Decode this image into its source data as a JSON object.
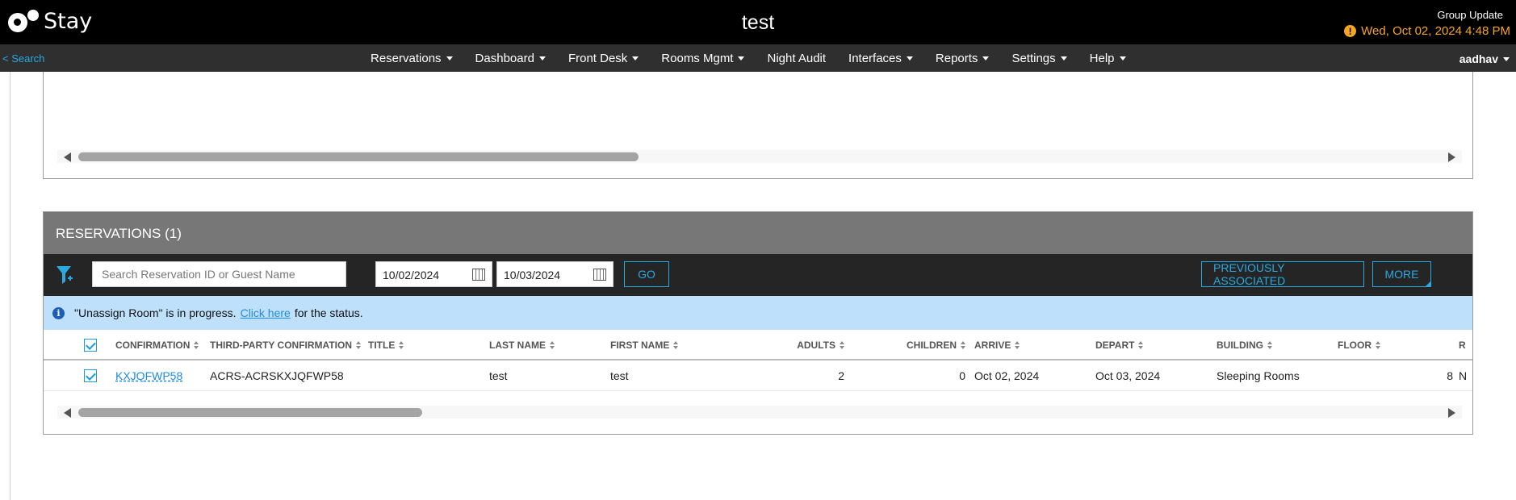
{
  "header": {
    "logo_text": "Stay",
    "title": "test",
    "group_update": "Group Update",
    "datetime": "Wed, Oct 02, 2024 4:48 PM",
    "warning_glyph": "!"
  },
  "nav": {
    "back_search": "< Search",
    "items": [
      {
        "label": "Reservations",
        "dropdown": true
      },
      {
        "label": "Dashboard",
        "dropdown": true
      },
      {
        "label": "Front Desk",
        "dropdown": true
      },
      {
        "label": "Rooms Mgmt",
        "dropdown": true
      },
      {
        "label": "Night Audit",
        "dropdown": false
      },
      {
        "label": "Interfaces",
        "dropdown": true
      },
      {
        "label": "Reports",
        "dropdown": true
      },
      {
        "label": "Settings",
        "dropdown": true
      },
      {
        "label": "Help",
        "dropdown": true
      }
    ],
    "user": "aadhav"
  },
  "reservations": {
    "title": "RESERVATIONS (1)",
    "search_placeholder": "Search Reservation ID or Guest Name",
    "date_from": "10/02/2024",
    "date_to": "10/03/2024",
    "go_label": "GO",
    "prev_assoc_label": "PREVIOUSLY ASSOCIATED",
    "more_label": "MORE",
    "info": {
      "glyph": "i",
      "text_before": "\"Unassign Room\" is in progress.",
      "link": "Click here",
      "text_after": "for the status."
    },
    "columns": {
      "confirmation": "CONFIRMATION",
      "third_party": "THIRD-PARTY CONFIRMATION",
      "title": "TITLE",
      "last_name": "LAST NAME",
      "first_name": "FIRST NAME",
      "adults": "ADULTS",
      "children": "CHILDREN",
      "arrive": "ARRIVE",
      "depart": "DEPART",
      "building": "BUILDING",
      "floor": "FLOOR",
      "room": "R"
    },
    "rows": [
      {
        "checked": true,
        "confirmation": "KXJQFWP58",
        "third_party": "ACRS-ACRSKXJQFWP58",
        "title": "",
        "last_name": "test",
        "first_name": "test",
        "adults": "2",
        "children": "0",
        "arrive": "Oct 02, 2024",
        "depart": "Oct 03, 2024",
        "building": "Sleeping Rooms",
        "floor": "8",
        "room": "N"
      }
    ]
  },
  "colors": {
    "accent": "#29a9e0",
    "warning": "#f5a623",
    "info_bg": "#bfe0fb"
  }
}
